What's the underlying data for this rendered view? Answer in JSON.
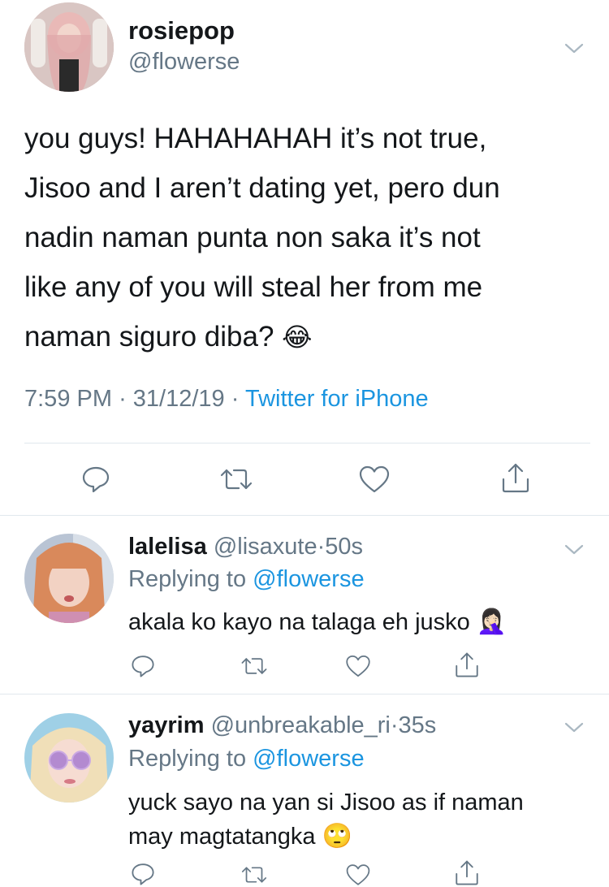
{
  "main_tweet": {
    "display_name": "rosiepop",
    "handle": "@flowerse",
    "text_lines": [
      "you guys! HAHAHAHAH it’s not true,",
      "Jisoo and I aren’t dating yet, pero dun",
      "nadin naman punta non saka it’s not",
      "like any of you will steal her from me",
      "naman siguro diba?"
    ],
    "emoji": "😂",
    "time": "7:59 PM",
    "sep1": "·",
    "date": "31/12/19",
    "sep2": "·",
    "source": "Twitter for iPhone"
  },
  "replies": [
    {
      "display_name": "lalelisa",
      "handle": "@lisaxute",
      "sep": "·",
      "age": "50s",
      "replying_label": "Replying to",
      "replying_to": "@flowerse",
      "text": "akala ko kayo na talaga eh jusko",
      "emoji": "🤦🏻‍♀️"
    },
    {
      "display_name": "yayrim",
      "handle": "@unbreakable_ri",
      "sep": "·",
      "age": "35s",
      "replying_label": "Replying to",
      "replying_to": "@flowerse",
      "text_lines": [
        "yuck sayo na yan si Jisoo as if naman",
        "may magtatangka"
      ],
      "emoji": "🙄"
    }
  ],
  "colors": {
    "text": "#14171a",
    "secondary": "#657786",
    "link": "#1b95e0",
    "divider": "#e1e8ed"
  }
}
